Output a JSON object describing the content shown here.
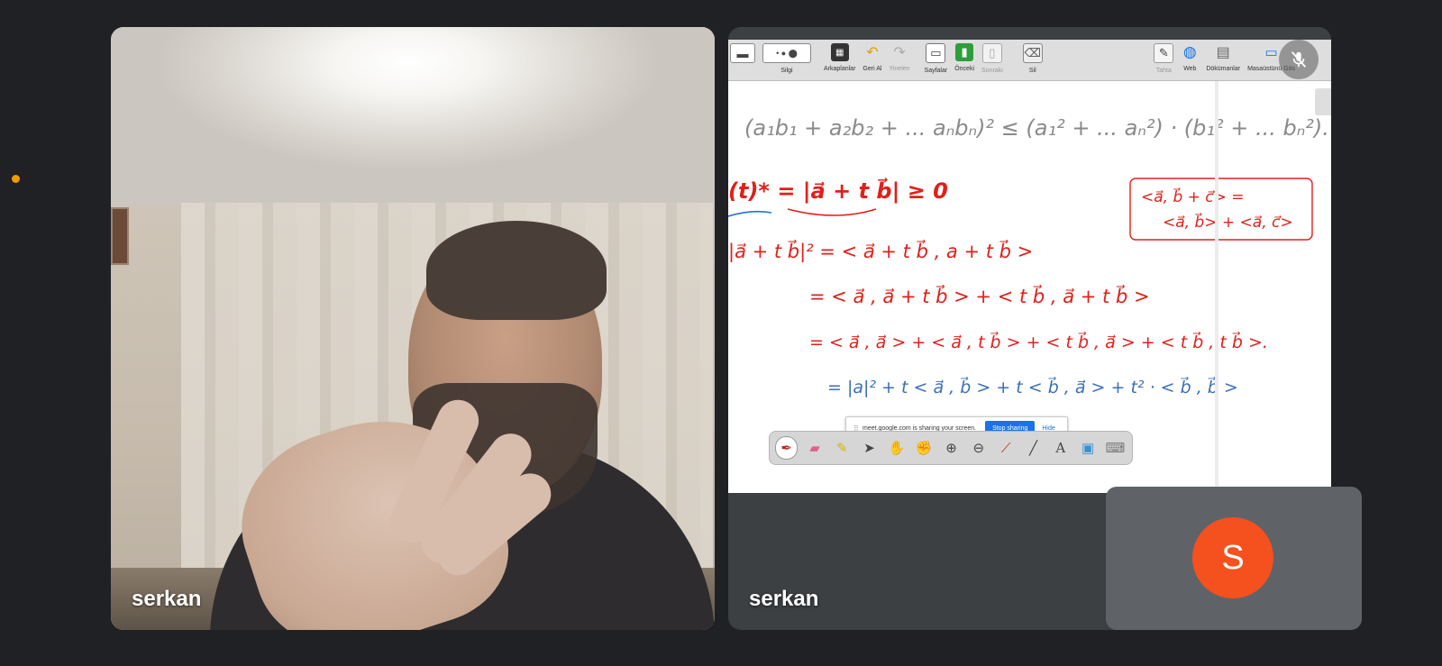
{
  "participants": {
    "camera_tile": {
      "name": "serkan"
    },
    "share_tile": {
      "name": "serkan"
    },
    "self_tile": {
      "avatar_initial": "S",
      "avatar_color": "#f4511e"
    }
  },
  "status_dot_color": "#f29900",
  "shared_screen": {
    "toolbar": {
      "items": [
        {
          "icon": "line-width-icon",
          "label": ""
        },
        {
          "icon": "pen-size-icon",
          "label": "Silgi"
        },
        {
          "icon": "background-icon",
          "label": "Arkaplanlar"
        },
        {
          "icon": "undo-icon",
          "label": "Geri Al"
        },
        {
          "icon": "redo-icon",
          "label": "Yinelen"
        },
        {
          "icon": "pages-icon",
          "label": "Sayfalar"
        },
        {
          "icon": "previous-icon",
          "label": "Önceki"
        },
        {
          "icon": "next-icon",
          "label": "Sonraki"
        },
        {
          "icon": "delete-icon",
          "label": "Sil"
        },
        {
          "icon": "board-icon",
          "label": "Tahta"
        },
        {
          "icon": "web-icon",
          "label": "Web"
        },
        {
          "icon": "documents-icon",
          "label": "Dökümanlar"
        },
        {
          "icon": "desktop-icon",
          "label": "Masaüstünü Gös"
        }
      ]
    },
    "sharing_notice": {
      "text": "meet.google.com is sharing your screen.",
      "stop_label": "Stop sharing",
      "hide_label": "Hide"
    },
    "whiteboard": {
      "line1": "(a₁b₁ + a₂b₂ + ... aₙbₙ)² ≤ (a₁² + ... aₙ²) · (b₁² + ... bₙ²).",
      "line2": "(t)* = |a⃗ + t b⃗| ≥ 0",
      "box_top": "<a⃗, b⃗ + c⃗> =",
      "box_bottom": "<a⃗, b⃗> + <a⃗, c⃗>",
      "line3": "|a⃗ + t b⃗|² = < a⃗ + t b⃗ , a + t b⃗ >",
      "line4": "= < a⃗ , a⃗ + t b⃗ > + < t b⃗ , a⃗ + t b⃗ >",
      "line5": "= < a⃗ , a⃗ > + < a⃗ , t b⃗ > + < t b⃗ , a⃗ > + < t b⃗ , t b⃗ >.",
      "line6": "= |a|² + t < a⃗ , b⃗ > + t < b⃗ , a⃗ > + t² · < b⃗ , b⃗ >"
    },
    "pen_toolbar": [
      "pen-icon",
      "eraser-icon",
      "highlighter-icon",
      "pointer-icon",
      "hand-icon",
      "pan-icon",
      "zoom-in-icon",
      "zoom-out-icon",
      "laser-icon",
      "line-icon",
      "text-icon",
      "screenshot-icon",
      "keyboard-icon"
    ]
  }
}
